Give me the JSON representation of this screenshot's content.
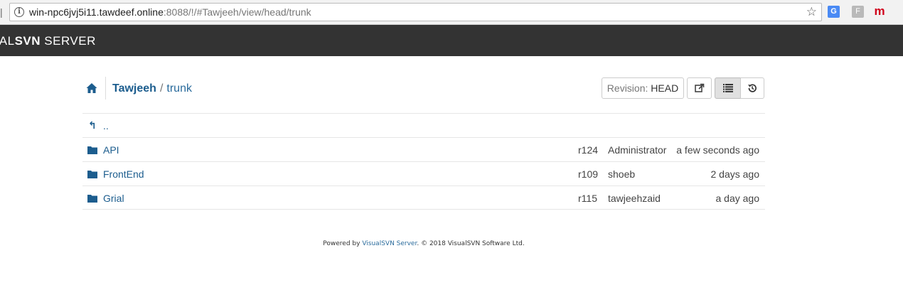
{
  "browser": {
    "url_host": "win-npc6jvj5i11.tawdeef.online",
    "url_rest": ":8088/!/#Tawjeeh/view/head/trunk",
    "ext_translate": "G",
    "ext_f": "F",
    "ext_m": "m"
  },
  "header": {
    "brand_light": "UAL",
    "brand_bold": "SVN",
    "brand_suffix": " SERVER"
  },
  "toolbar": {
    "repo": "Tawjeeh",
    "slash": "/",
    "path": "trunk",
    "revision_label": "Revision:",
    "revision_value": "HEAD"
  },
  "listing": {
    "parent_label": "..",
    "rows": [
      {
        "name": "API",
        "revision": "r124",
        "author": "Administrator",
        "date": "a few seconds ago"
      },
      {
        "name": "FrontEnd",
        "revision": "r109",
        "author": "shoeb",
        "date": "2 days ago"
      },
      {
        "name": "Grial",
        "revision": "r115",
        "author": "tawjeehzaid",
        "date": "a day ago"
      }
    ]
  },
  "footer": {
    "prefix": "Powered by ",
    "link": "VisualSVN Server",
    "suffix": ". © 2018 VisualSVN Software Ltd."
  },
  "colors": {
    "link": "#1c5d8e",
    "header_bg": "#333333"
  }
}
